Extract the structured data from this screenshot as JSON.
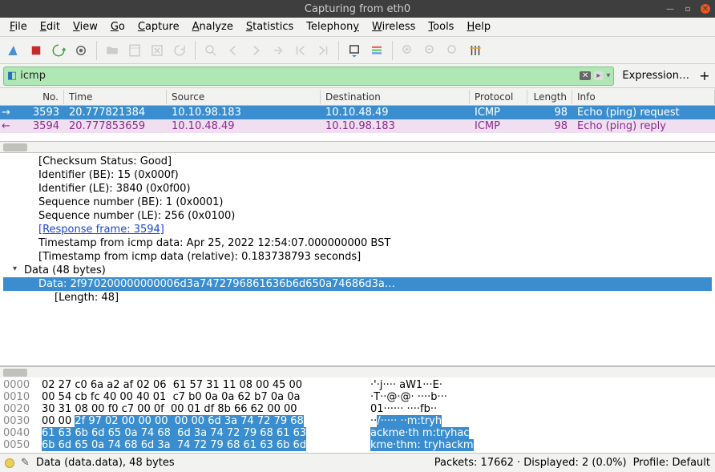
{
  "title": "Capturing from eth0",
  "menu": [
    "File",
    "Edit",
    "View",
    "Go",
    "Capture",
    "Analyze",
    "Statistics",
    "Telephony",
    "Wireless",
    "Tools",
    "Help"
  ],
  "filter": {
    "value": "icmp",
    "expression_label": "Expression…"
  },
  "columns": {
    "no": "No.",
    "time": "Time",
    "src": "Source",
    "dst": "Destination",
    "proto": "Protocol",
    "len": "Length",
    "info": "Info"
  },
  "rows": [
    {
      "no": "3593",
      "time": "20.777821384",
      "src": "10.10.98.183",
      "dst": "10.10.48.49",
      "proto": "ICMP",
      "len": "98",
      "info": "Echo (ping) request",
      "kind": "req"
    },
    {
      "no": "3594",
      "time": "20.777853659",
      "src": "10.10.48.49",
      "dst": "10.10.98.183",
      "proto": "ICMP",
      "len": "98",
      "info": "Echo (ping) reply",
      "kind": "rep"
    }
  ],
  "details": {
    "l0": "[Checksum Status: Good]",
    "l1": "Identifier (BE): 15 (0x000f)",
    "l2": "Identifier (LE): 3840 (0x0f00)",
    "l3": "Sequence number (BE): 1 (0x0001)",
    "l4": "Sequence number (LE): 256 (0x0100)",
    "l5": "[Response frame: 3594]",
    "l6": "Timestamp from icmp data: Apr 25, 2022 12:54:07.000000000 BST",
    "l7": "[Timestamp from icmp data (relative): 0.183738793 seconds]",
    "l8": "Data (48 bytes)",
    "l9": "Data: 2f970200000000006d3a7472796861636b6d650a74686d3a…",
    "l10": "[Length: 48]"
  },
  "hex": [
    {
      "off": "0000",
      "b1": "02 27 c0 6a a2 af 02 06  61 57 31 11 08 00 45 00",
      "a1": "·'·j···· aW1···E·"
    },
    {
      "off": "0010",
      "b1": "00 54 cb fc 40 00 40 01  c7 b0 0a 0a 62 b7 0a 0a",
      "a1": "·T··@·@· ····b···"
    },
    {
      "off": "0020",
      "b1": "30 31 08 00 f0 c7 00 0f  00 01 df 8b 66 62 00 00",
      "a1": "01······ ····fb··"
    },
    {
      "off": "0030",
      "b1p": "00 00 ",
      "b1h": "2f 97 02 00 00 00  00 00 6d 3a 74 72 79 68",
      "a1p": "··",
      "a1h": "/····· ··m:tryh"
    },
    {
      "off": "0040",
      "b1h": "61 63 6b 6d 65 0a 74 68  6d 3a 74 72 79 68 61 63",
      "a1h": "ackme·th m:tryhac"
    },
    {
      "off": "0050",
      "b1h": "6b 6d 65 0a 74 68 6d 3a  74 72 79 68 61 63 6b 6d",
      "a1h": "kme·thm: tryhackm"
    }
  ],
  "status": {
    "left": "Data (data.data), 48 bytes",
    "packets": "Packets: 17662 · Displayed: 2 (0.0%)",
    "profile": "Profile: Default"
  }
}
